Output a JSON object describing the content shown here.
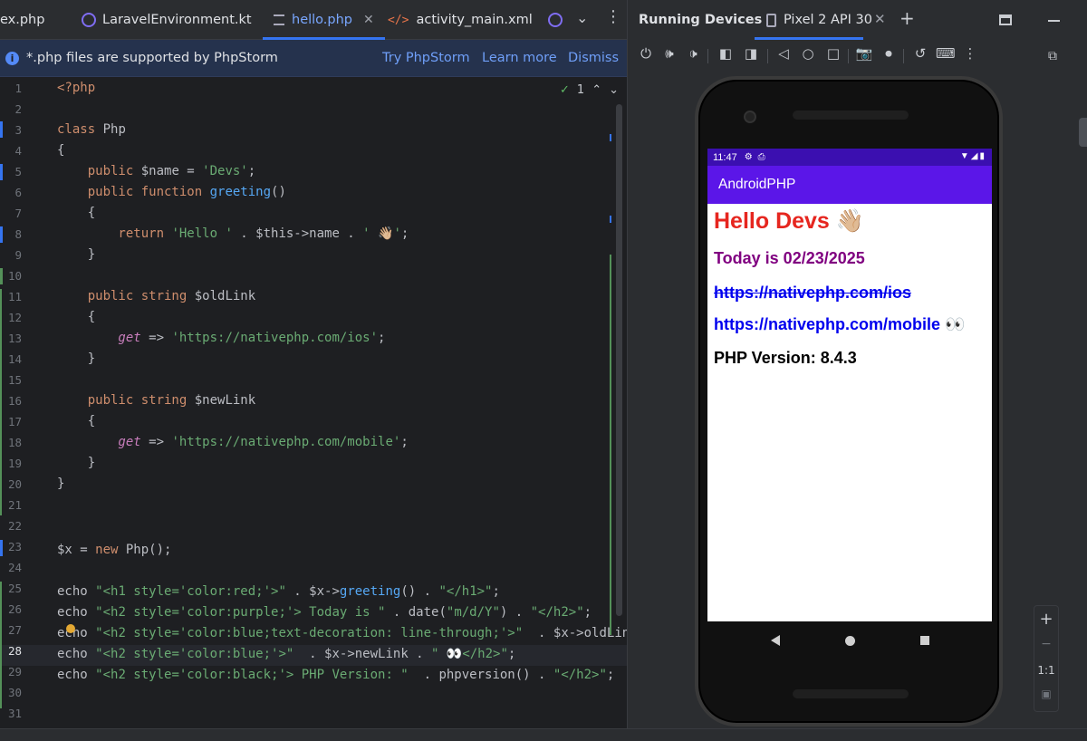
{
  "tabs": [
    {
      "label": "ex.php",
      "icon": "php-file-icon"
    },
    {
      "label": "LaravelEnvironment.kt",
      "icon": "kotlin-class-icon"
    },
    {
      "label": "hello.php",
      "icon": "php-file-icon",
      "active": true
    },
    {
      "label": "activity_main.xml",
      "icon": "xml-file-icon"
    }
  ],
  "banner": {
    "message": "*.php files are supported by PhpStorm",
    "try_label": "Try PhpStorm",
    "learn_label": "Learn more",
    "dismiss_label": "Dismiss"
  },
  "inspection": {
    "count": "1"
  },
  "code_lines": [
    {
      "n": "1"
    },
    {
      "n": "2"
    },
    {
      "n": "3"
    },
    {
      "n": "4"
    },
    {
      "n": "5"
    },
    {
      "n": "6"
    },
    {
      "n": "7"
    },
    {
      "n": "8"
    },
    {
      "n": "9"
    },
    {
      "n": "10"
    },
    {
      "n": "11"
    },
    {
      "n": "12"
    },
    {
      "n": "13"
    },
    {
      "n": "14"
    },
    {
      "n": "15"
    },
    {
      "n": "16"
    },
    {
      "n": "17"
    },
    {
      "n": "18"
    },
    {
      "n": "19"
    },
    {
      "n": "20"
    },
    {
      "n": "21"
    },
    {
      "n": "22"
    },
    {
      "n": "23"
    },
    {
      "n": "24"
    },
    {
      "n": "25"
    },
    {
      "n": "26"
    },
    {
      "n": "27"
    },
    {
      "n": "28"
    },
    {
      "n": "29"
    },
    {
      "n": "30"
    },
    {
      "n": "31"
    }
  ],
  "code": {
    "l1": "<?php",
    "l3a": "class",
    "l3b": " Php",
    "l4": "{",
    "l5a": "    public",
    "l5b": " $name = ",
    "l5c": "'Devs'",
    "l5d": ";",
    "l6a": "    public function",
    "l6b": " greeting",
    "l6c": "()",
    "l7": "    {",
    "l8a": "        return",
    "l8b": " 'Hello '",
    "l8c": " . $this->name . ",
    "l8d": "' 👋🏼'",
    "l8e": ";",
    "l9": "    }",
    "l11a": "    public string",
    "l11b": " $oldLink",
    "l12": "    {",
    "l13a": "        get",
    "l13b": " => ",
    "l13c": "'https://nativephp.com/ios'",
    "l13d": ";",
    "l14": "    }",
    "l16a": "    public string",
    "l16b": " $newLink",
    "l17": "    {",
    "l18a": "        get",
    "l18b": " => ",
    "l18c": "'https://nativephp.com/mobile'",
    "l18d": ";",
    "l19": "    }",
    "l20": "}",
    "l23a": "$x = ",
    "l23b": "new",
    "l23c": " Php();",
    "l25a": "echo ",
    "l25b": "\"<h1 style='color:red;'>\"",
    "l25c": " . $x->",
    "l25d": "greeting",
    "l25e": "() . ",
    "l25f": "\"</h1>\"",
    "l25g": ";",
    "l26a": "echo ",
    "l26b": "\"<h2 style='color:purple;'> Today is \"",
    "l26c": " . date(",
    "l26d": "\"m/d/Y\"",
    "l26e": ") . ",
    "l26f": "\"</h2>\"",
    "l26g": ";",
    "l27a": "echo ",
    "l27b": "\"<h2 style='color:blue;text-decoration: line-through;'>\"",
    "l27c": "  . $x->oldLink",
    "l28a": "echo ",
    "l28b": "\"<h2 style='color:blue;'>\"",
    "l28c": "  . $x->newLink . ",
    "l28d": "\" 👀</h2>\"",
    "l28e": ";",
    "l29a": "echo ",
    "l29b": "\"<h2 style='color:black;'> PHP Version: \"",
    "l29c": "  . phpversion() . ",
    "l29d": "\"</h2>\"",
    "l29e": ";"
  },
  "right_panel": {
    "title": "Running Devices",
    "device_tab": "Pixel 2 API 30"
  },
  "phone": {
    "time": "11:47",
    "app_title": "AndroidPHP",
    "h1": "Hello Devs 👋🏼",
    "today": "Today is 02/23/2025",
    "old_link": "https://nativephp.com/ios",
    "new_link": "https://nativephp.com/mobile 👀",
    "php_version": "PHP Version: 8.4.3"
  },
  "zoom": {
    "plus": "+",
    "minus": "−",
    "ratio": "1:1"
  },
  "colors": {
    "accent": "#3574f0",
    "app_bar": "#5b16e8",
    "status_bar": "#3b0fb0",
    "h1": "#e6261f",
    "purple": "#800080",
    "blue": "#0000ee"
  }
}
